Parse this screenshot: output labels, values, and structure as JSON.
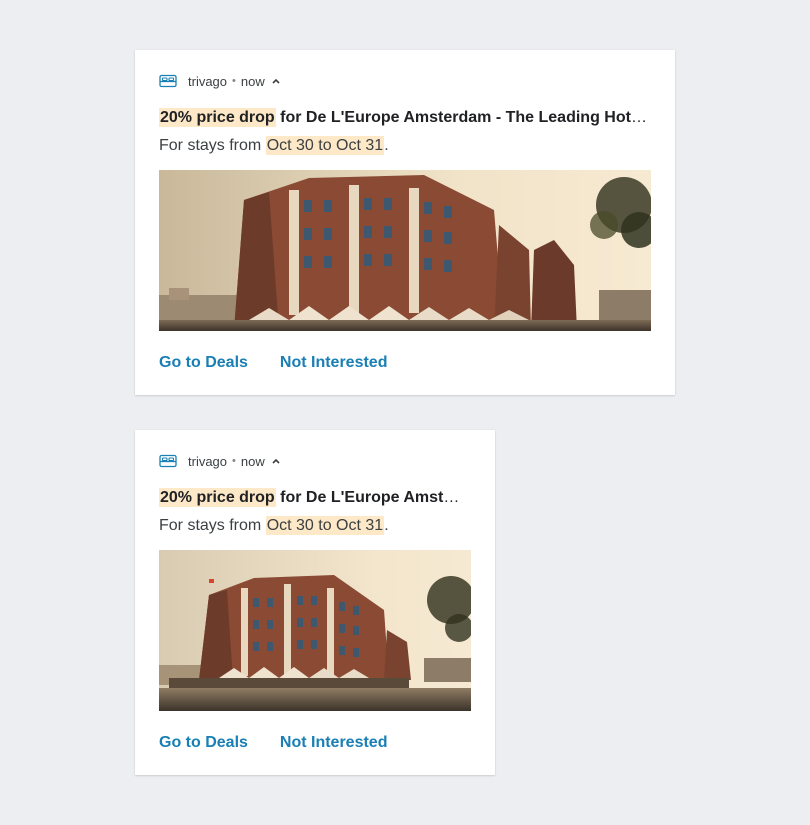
{
  "colors": {
    "background": "#eceef1",
    "card": "#ffffff",
    "highlight": "#fde8c8",
    "action": "#1a7fb4",
    "app_icon": "#1a7fb4"
  },
  "notifications": [
    {
      "app_icon": "bed-icon",
      "app_name": "trivago",
      "separator": "•",
      "time": "now",
      "expand_icon": "chevron-up-icon",
      "title_highlight": "20% price drop",
      "title_rest": " for De L'Europe Amsterdam - The Leading Hotels of…",
      "subtitle_prefix": "For stays from ",
      "subtitle_highlight": "Oct 30 to Oct 31",
      "subtitle_suffix": ".",
      "image": "hotel-photo",
      "actions": [
        "Go to Deals",
        "Not Interested"
      ]
    },
    {
      "app_icon": "bed-icon",
      "app_name": "trivago",
      "separator": "•",
      "time": "now",
      "expand_icon": "chevron-up-icon",
      "title_highlight": "20% price drop",
      "title_rest": " for De L'Europe Amsterda…",
      "subtitle_prefix": "For stays from ",
      "subtitle_highlight": "Oct 30 to Oct 31",
      "subtitle_suffix": ".",
      "image": "hotel-photo",
      "actions": [
        "Go to Deals",
        "Not Interested"
      ]
    }
  ]
}
